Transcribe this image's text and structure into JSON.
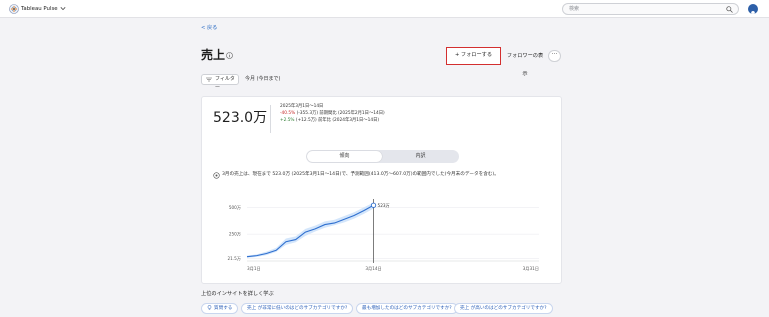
{
  "app": {
    "name": "Tableau Pulse"
  },
  "search": {
    "placeholder": "検索"
  },
  "nav": {
    "back_label": "< 戻る"
  },
  "metric": {
    "title": "売上",
    "follow_label": "+ フォローする",
    "followers_label": "フォロワーの表示",
    "more_label": "···"
  },
  "filters": {
    "filter_label": "フィルター",
    "period_label": "今月 (今日まで)"
  },
  "summary": {
    "value": "523.0万",
    "date_range": "2025年3月1日～14日",
    "comparisons": [
      {
        "change": "-40.5%",
        "rest": " (-355.3万) 前期間比 (2025年2月1日～14日)"
      },
      {
        "change": "+2.5%",
        "rest": " (+12.5万) 前年比 (2024年3月1日～14日)"
      }
    ]
  },
  "view_toggle": {
    "options": [
      "傾向",
      "内訳"
    ],
    "selected": "傾向"
  },
  "insight": {
    "text": "3月の売上は、現在まで 523.0万 (2025年3月1日～14日)で、予測範囲(413.0万～607.0万)の範囲内でした(今月末のデータを含む)。"
  },
  "chart_data": {
    "type": "line",
    "x": [
      "3月1日",
      "3月2日",
      "3月3日",
      "3月4日",
      "3月5日",
      "3月6日",
      "3月7日",
      "3月8日",
      "3月9日",
      "3月10日",
      "3月11日",
      "3月12日",
      "3月13日",
      "3月14日"
    ],
    "values": [
      40,
      50,
      70,
      100,
      180,
      200,
      270,
      300,
      340,
      355,
      390,
      425,
      470,
      520
    ],
    "band_low": [
      30,
      38,
      55,
      85,
      150,
      175,
      235,
      275,
      310,
      335,
      360,
      395,
      440,
      490
    ],
    "band_high": [
      50,
      62,
      88,
      122,
      210,
      230,
      300,
      330,
      370,
      385,
      420,
      455,
      500,
      545
    ],
    "ytick_labels": [
      "21.5万",
      "250万",
      "500万"
    ],
    "ytick_values": [
      21.5,
      250,
      500
    ],
    "ylim": [
      0,
      560
    ],
    "x_domain_days": 31,
    "xtick_labels": [
      "3月1日",
      "3月14日",
      "3月31日"
    ],
    "xtick_days": [
      1,
      14,
      31
    ],
    "current_point_label": "523万",
    "colors": {
      "line": "#2f6fcf",
      "band": "#d4e6fb",
      "marker_line": "#444444"
    }
  },
  "more_insights": {
    "heading": "上位のインサイトを詳しく学ぶ",
    "chips": [
      {
        "icon": "lightbulb-icon",
        "label": "質問する"
      },
      {
        "icon": "",
        "label": "売上 が非常に低いのはどのサブカテゴリですか?"
      },
      {
        "icon": "",
        "label": "最も増加したのはどのサブカテゴリですか?"
      },
      {
        "icon": "",
        "label": "売上 が高いのはどのサブカテゴリですか?"
      }
    ]
  }
}
